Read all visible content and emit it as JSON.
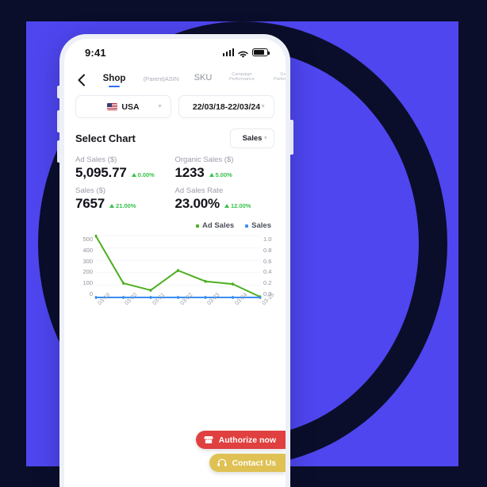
{
  "theme": {
    "bg_dark": "#0a0e2a",
    "bg_blue": "#4f46f0",
    "accent_green": "#35c24a",
    "line_ad_sales": "#4caf1f",
    "line_sales": "#3a8ff0",
    "tab_underline": "#2f6ef3"
  },
  "status_bar": {
    "time": "9:41",
    "signal_icon": "signal-bars-icon",
    "wifi_icon": "wifi-icon",
    "battery_icon": "battery-icon"
  },
  "nav": {
    "back_icon": "chevron-left-icon",
    "tabs": [
      {
        "label": "Shop",
        "active": true
      },
      {
        "label": "(Parent)ASIN",
        "active": false
      },
      {
        "label": "SKU",
        "active": false
      },
      {
        "label": "Campaign\nPerformance",
        "active": false
      },
      {
        "label": "Group\nPerformance",
        "active": false
      }
    ]
  },
  "filters": {
    "country": {
      "label": "USA",
      "icon": "us-flag-icon",
      "caret": "caret-down-icon"
    },
    "date_range": {
      "label": "22/03/18-22/03/24",
      "caret": "caret-down-icon"
    }
  },
  "select_chart": {
    "title": "Select Chart",
    "dropdown_value": "Sales",
    "caret": "caret-down-icon"
  },
  "metrics": [
    {
      "label": "Ad Sales ($)",
      "value": "5,095.77",
      "delta": "0.00%",
      "trend": "up"
    },
    {
      "label": "Organic Sales  ($)",
      "value": "1233",
      "delta": "5.00%",
      "trend": "up"
    },
    {
      "label": "Sales ($)",
      "value": "7657",
      "delta": "21.00%",
      "trend": "up"
    },
    {
      "label": "Ad Sales Rate",
      "value": "23.00%",
      "delta": "12.00%",
      "trend": "up"
    }
  ],
  "legend": [
    {
      "label": "Ad Sales",
      "color": "#4caf1f"
    },
    {
      "label": "Sales",
      "color": "#3a8ff0"
    }
  ],
  "chart_data": {
    "type": "line",
    "title": "",
    "xlabel": "",
    "ylabel": "",
    "categories": [
      "03-19",
      "03-20",
      "03-21",
      "03-22",
      "03-23",
      "03-24",
      "03-25"
    ],
    "left_axis": {
      "ticks": [
        500,
        400,
        300,
        200,
        100,
        0
      ],
      "ylim": [
        0,
        500
      ]
    },
    "right_axis": {
      "ticks": [
        "1.0",
        "0.8",
        "0.6",
        "0.4",
        "0.2",
        "0.0"
      ],
      "ylim": [
        0,
        1
      ]
    },
    "grid": true,
    "legend_position": "top-right",
    "series": [
      {
        "name": "Ad Sales",
        "color": "#4caf1f",
        "axis": "left",
        "values": [
          495,
          115,
          58,
          218,
          130,
          108,
          5
        ]
      },
      {
        "name": "Sales",
        "color": "#3a8ff0",
        "axis": "right",
        "values": [
          0,
          0,
          0,
          0,
          0,
          0,
          0
        ]
      }
    ]
  },
  "floating_buttons": [
    {
      "label": "Authorize now",
      "icon": "store-icon",
      "color": "#e0403f"
    },
    {
      "label": "Contact Us",
      "icon": "headset-icon",
      "color": "#dfc154"
    }
  ]
}
